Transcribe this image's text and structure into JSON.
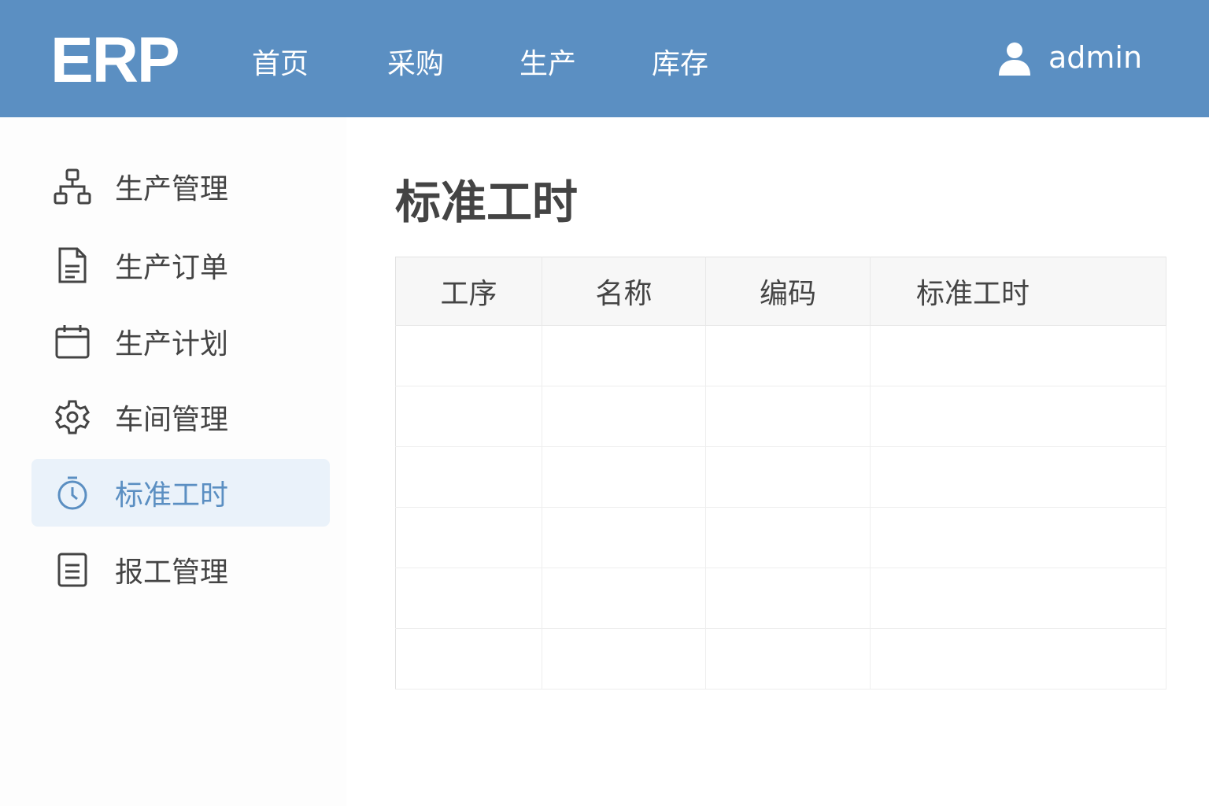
{
  "header": {
    "logo": "ERP",
    "nav": [
      "首页",
      "采购",
      "生产",
      "库存"
    ],
    "user": "admin"
  },
  "sidebar": {
    "items": [
      {
        "label": "生产管理",
        "icon": "sitemap-icon"
      },
      {
        "label": "生产订单",
        "icon": "document-icon"
      },
      {
        "label": "生产计划",
        "icon": "calendar-icon"
      },
      {
        "label": "车间管理",
        "icon": "gear-icon"
      },
      {
        "label": "标准工时",
        "icon": "stopwatch-icon",
        "active": true
      },
      {
        "label": "报工管理",
        "icon": "form-icon"
      }
    ]
  },
  "main": {
    "title": "标准工时",
    "columns": [
      "工序",
      "名称",
      "编码",
      "标准工时"
    ]
  },
  "colors": {
    "header": "#5b8fc2",
    "active_bg": "#eaf2fa"
  }
}
